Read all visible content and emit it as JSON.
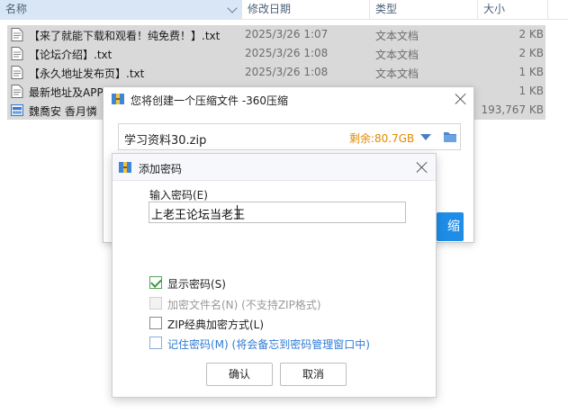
{
  "columns": {
    "name": "名称",
    "date": "修改日期",
    "type": "类型",
    "size": "大小"
  },
  "files": [
    {
      "name": "【来了就能下载和观看！纯免费！】.txt",
      "date": "2025/3/26 1:07",
      "type": "文本文档",
      "size": "2 KB",
      "icon": "text-file-icon"
    },
    {
      "name": "【论坛介绍】.txt",
      "date": "2025/3/26 1:08",
      "type": "文本文档",
      "size": "2 KB",
      "icon": "text-file-icon"
    },
    {
      "name": "【永久地址发布页】.txt",
      "date": "2025/3/26 1:08",
      "type": "文本文档",
      "size": "1 KB",
      "icon": "text-file-icon"
    },
    {
      "name": "最新地址及APP",
      "date": "",
      "type": "",
      "size": "1 KB",
      "icon": "text-file-icon"
    },
    {
      "name": "魏喬安 香月憐",
      "date": "",
      "type": "",
      "size": "193,767 KB",
      "icon": "video-file-icon"
    }
  ],
  "compress_dialog": {
    "title": "您将创建一个压缩文件 -360压缩",
    "path_value": "学习资料30.zip",
    "free_space": "剩余:80.7GB",
    "compress_button": "缩"
  },
  "password_dialog": {
    "title": "添加密码",
    "input_label": "输入密码(E)",
    "password_value": "上老王论坛当老王",
    "options": {
      "show_password": "显示密码(S)",
      "encrypt_filename": "加密文件名(N) (不支持ZIP格式)",
      "zip_classic": "ZIP经典加密方式(L)",
      "remember": "记住密码(M) (将会备忘到密码管理窗口中)"
    },
    "ok_button": "确认",
    "cancel_button": "取消"
  },
  "colors": {
    "accent": "#1e8de8",
    "free_space": "#e08a00",
    "link": "#2f7ad6"
  }
}
